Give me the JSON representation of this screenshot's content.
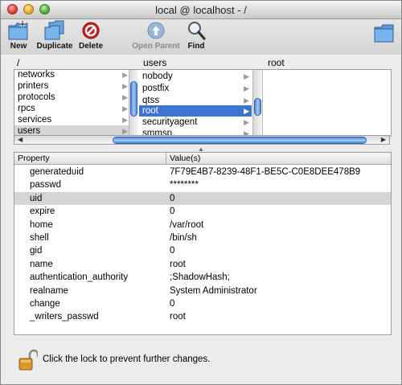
{
  "window": {
    "title": "local @ localhost - /"
  },
  "toolbar": {
    "buttons": [
      {
        "label": "New",
        "icon": "new-folder-icon",
        "enabled": true
      },
      {
        "label": "Duplicate",
        "icon": "duplicate-icon",
        "enabled": true
      },
      {
        "label": "Delete",
        "icon": "delete-icon",
        "enabled": true
      },
      {
        "label": "Open Parent",
        "icon": "open-parent-icon",
        "enabled": false
      },
      {
        "label": "Find",
        "icon": "magnifier-icon",
        "enabled": true
      }
    ]
  },
  "browser": {
    "column_headers": [
      "/",
      "users",
      "root"
    ],
    "columns": [
      {
        "items": [
          "networks",
          "printers",
          "protocols",
          "rpcs",
          "services",
          "users"
        ],
        "selected": "users"
      },
      {
        "items": [
          "nobody",
          "postfix",
          "qtss",
          "root",
          "securityagent",
          "smmsp"
        ],
        "selected": "root"
      },
      {
        "items": []
      }
    ]
  },
  "properties": {
    "headers": {
      "property": "Property",
      "value": "Value(s)"
    },
    "rows": [
      {
        "property": "generateduid",
        "value": "7F79E4B7-8239-48F1-BE5C-C0E8DEE478B9"
      },
      {
        "property": "passwd",
        "value": "********"
      },
      {
        "property": "uid",
        "value": "0",
        "selected": true
      },
      {
        "property": "expire",
        "value": "0"
      },
      {
        "property": "home",
        "value": "/var/root"
      },
      {
        "property": "shell",
        "value": "/bin/sh"
      },
      {
        "property": "gid",
        "value": "0"
      },
      {
        "property": "name",
        "value": "root"
      },
      {
        "property": "authentication_authority",
        "value": ";ShadowHash;"
      },
      {
        "property": "realname",
        "value": "System Administrator"
      },
      {
        "property": "change",
        "value": "0"
      },
      {
        "property": "_writers_passwd",
        "value": "root"
      }
    ]
  },
  "footer": {
    "lock_text": "Click the lock to prevent further changes.",
    "lock_state": "unlocked"
  },
  "colors": {
    "selection_blue": "#3d74d4",
    "selection_gray": "#d5d5d5",
    "delete_red": "#cc1f1f"
  }
}
